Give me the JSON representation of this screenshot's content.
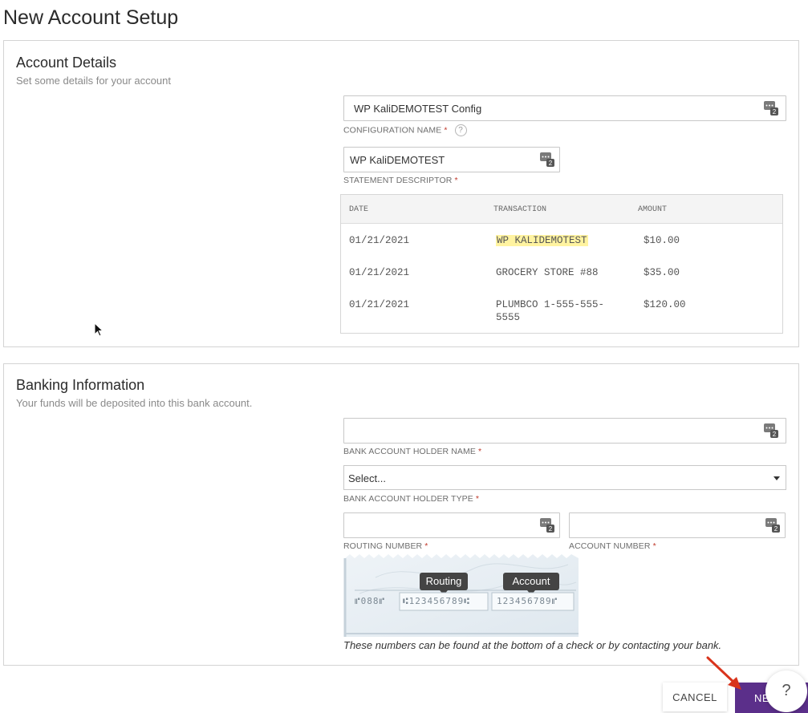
{
  "page": {
    "title": "New Account Setup"
  },
  "account_details": {
    "title": "Account Details",
    "subtitle": "Set some details for your account",
    "config_name_value": "WP KaliDEMOTEST Config",
    "config_name_label": "CONFIGURATION NAME",
    "statement_descriptor_value": "WP  KaliDEMOTEST",
    "statement_descriptor_label": "STATEMENT DESCRIPTOR",
    "required_marker": "*",
    "help_glyph": "?",
    "statement_table": {
      "headers": [
        "DATE",
        "TRANSACTION",
        "AMOUNT"
      ],
      "rows": [
        {
          "date": "01/21/2021",
          "transaction": "WP KALIDEMOTEST",
          "transaction_line2": "",
          "amount": "$10.00",
          "highlighted": true
        },
        {
          "date": "01/21/2021",
          "transaction": "GROCERY STORE #88",
          "transaction_line2": "",
          "amount": "$35.00",
          "highlighted": false
        },
        {
          "date": "01/21/2021",
          "transaction": "PLUMBCO 1-555-555-",
          "transaction_line2": "5555",
          "amount": "$120.00",
          "highlighted": false
        }
      ]
    }
  },
  "banking_info": {
    "title": "Banking Information",
    "subtitle": "Your funds will be deposited into this bank account.",
    "holder_name_value": "",
    "holder_name_label": "BANK ACCOUNT HOLDER NAME",
    "holder_type_value": "Select...",
    "holder_type_label": "BANK ACCOUNT HOLDER TYPE",
    "routing_number_value": "",
    "routing_number_label": "ROUTING NUMBER",
    "account_number_value": "",
    "account_number_label": "ACCOUNT NUMBER",
    "check_illustration": {
      "routing_tooltip": "Routing",
      "account_tooltip": "Account",
      "micr_prefix": "⑈088⑈",
      "micr_routing": "⑆123456789⑆",
      "micr_account": "123456789⑈"
    },
    "note": "These numbers can be found at the bottom of a check or by contacting your bank."
  },
  "footer": {
    "cancel_label": "CANCEL",
    "next_label": "NEXT",
    "help_label": "?"
  },
  "icons": {
    "field_icon": "keyboard-badge-icon",
    "dropdown_icon": "chevron-down-icon"
  },
  "colors": {
    "primary_button": "#5b2f8a",
    "highlight": "#fff3a0",
    "annotation_arrow": "#d9341c"
  }
}
